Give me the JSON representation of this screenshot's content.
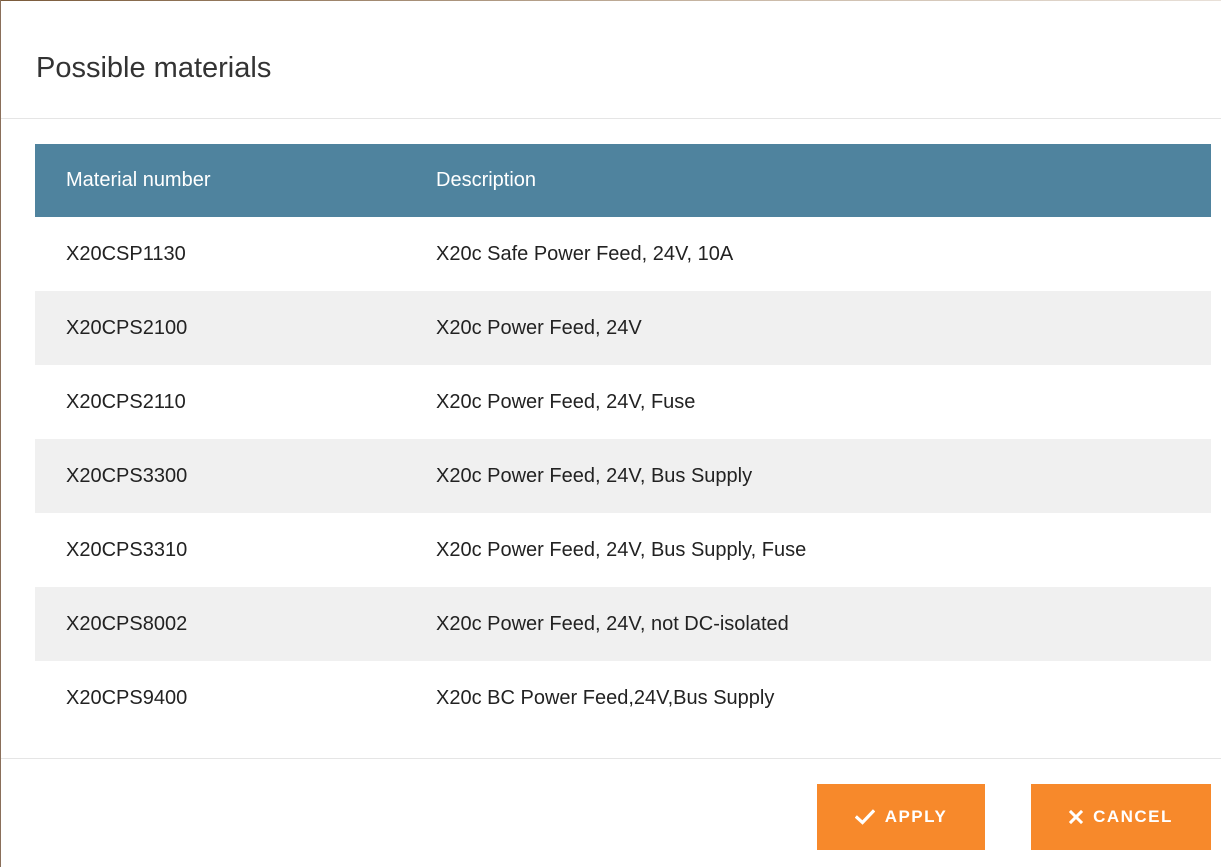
{
  "dialog": {
    "title": "Possible materials"
  },
  "table": {
    "headers": {
      "material_number": "Material number",
      "description": "Description"
    },
    "rows": [
      {
        "material_number": "X20CSP1130",
        "description": "X20c Safe Power Feed, 24V, 10A"
      },
      {
        "material_number": "X20CPS2100",
        "description": "X20c Power Feed, 24V"
      },
      {
        "material_number": "X20CPS2110",
        "description": "X20c Power Feed, 24V, Fuse"
      },
      {
        "material_number": "X20CPS3300",
        "description": "X20c Power Feed, 24V, Bus Supply"
      },
      {
        "material_number": "X20CPS3310",
        "description": "X20c Power Feed, 24V, Bus Supply, Fuse"
      },
      {
        "material_number": "X20CPS8002",
        "description": "X20c Power Feed, 24V, not DC-isolated"
      },
      {
        "material_number": "X20CPS9400",
        "description": "X20c BC Power Feed,24V,Bus Supply"
      }
    ]
  },
  "footer": {
    "apply_label": "APPLY",
    "apply_icon": "check-icon",
    "cancel_label": "CANCEL",
    "cancel_icon": "close-icon"
  },
  "colors": {
    "header_bg": "#4f839e",
    "button_bg": "#f7892b",
    "stripe": "#f0f0f0"
  }
}
